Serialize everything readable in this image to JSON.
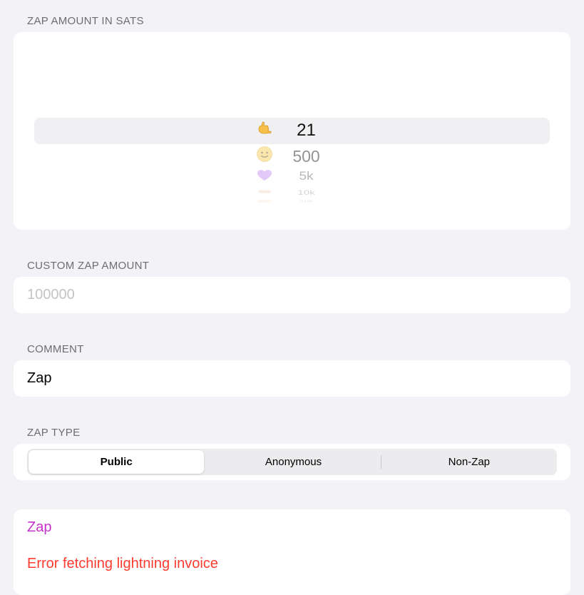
{
  "sections": {
    "zap_amount_header": "ZAP AMOUNT IN SATS",
    "custom_amount_header": "CUSTOM ZAP AMOUNT",
    "comment_header": "COMMENT",
    "zap_type_header": "ZAP TYPE"
  },
  "picker": {
    "selected_index": 0,
    "rows": [
      {
        "emoji": "call-me-hand-icon",
        "value": "21"
      },
      {
        "emoji": "slightly-smiling-face-icon",
        "value": "500"
      },
      {
        "emoji": "purple-heart-icon",
        "value": "5k"
      },
      {
        "emoji": "kiss-lips-icon",
        "value": "10k"
      },
      {
        "emoji": "emoji-icon",
        "value": "20k"
      }
    ]
  },
  "custom_amount": {
    "value": "",
    "placeholder": "100000"
  },
  "comment": {
    "value": "Zap",
    "placeholder": ""
  },
  "zap_type": {
    "options": [
      "Public",
      "Anonymous",
      "Non-Zap"
    ],
    "selected": "Public"
  },
  "action": {
    "zap_label": "Zap",
    "error": "Error fetching lightning invoice"
  },
  "colors": {
    "background": "#f2f2f7",
    "accent": "#c530c9",
    "error": "#ff3b30",
    "section_header": "#6d6d72"
  }
}
